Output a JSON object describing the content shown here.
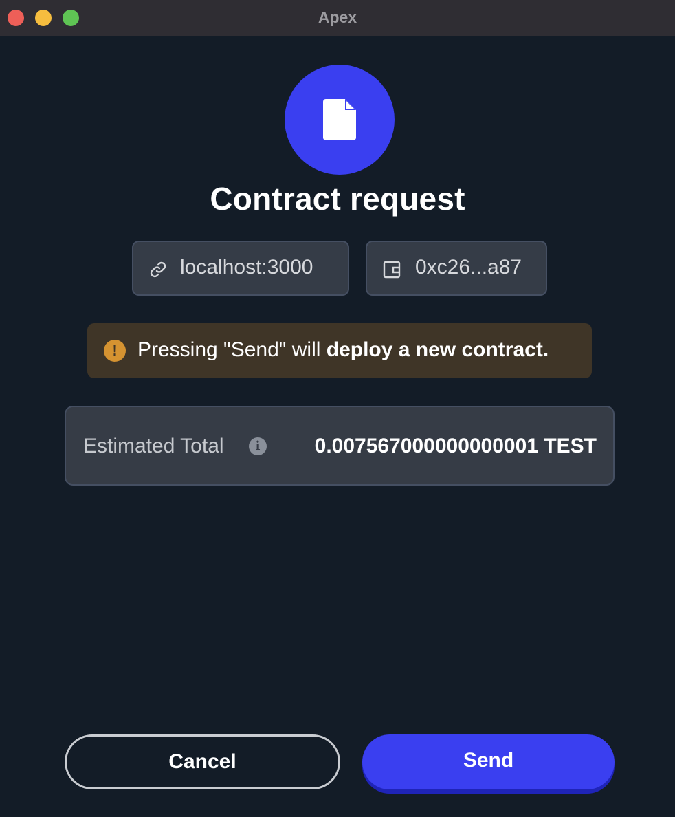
{
  "window": {
    "title": "Apex"
  },
  "header": {
    "title": "Contract request",
    "icon": "document-icon"
  },
  "chips": {
    "origin": {
      "icon": "link-icon",
      "label": "localhost:3000"
    },
    "account": {
      "icon": "wallet-icon",
      "label": "0xc26...a87"
    }
  },
  "warning": {
    "icon": "exclamation-icon",
    "text_prefix": "Pressing \"Send\" will ",
    "text_bold": "deploy a new contract."
  },
  "estimate": {
    "label": "Estimated Total",
    "info_icon": "info-icon",
    "value": "0.007567000000000001 TEST"
  },
  "actions": {
    "cancel_label": "Cancel",
    "send_label": "Send"
  },
  "colors": {
    "background": "#131c27",
    "accent": "#3a3ff0",
    "warning_bg": "#3f3527",
    "warning_icon": "#d59331"
  }
}
